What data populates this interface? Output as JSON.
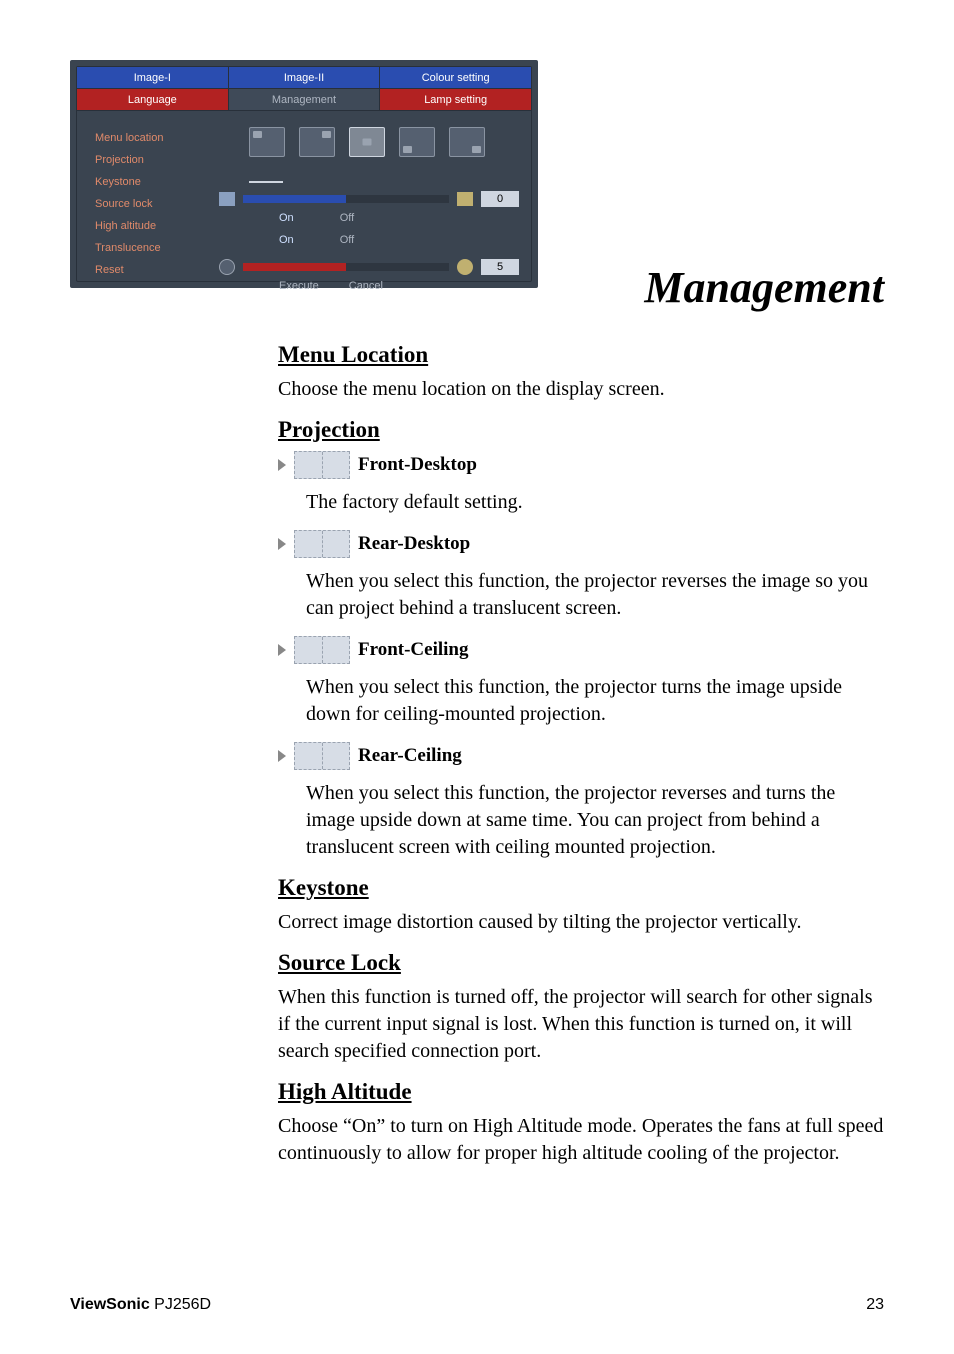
{
  "osd": {
    "tabs_top": [
      "Image-I",
      "Image-II",
      "Colour setting"
    ],
    "tabs_bottom": [
      "Language",
      "Management",
      "Lamp setting"
    ],
    "items": {
      "menu_location": "Menu location",
      "projection": "Projection",
      "keystone": "Keystone",
      "source_lock": "Source lock",
      "high_altitude": "High altitude",
      "translucence": "Translucence",
      "reset": "Reset"
    },
    "values": {
      "keystone": "0",
      "source_lock_on": "On",
      "source_lock_off": "Off",
      "high_altitude_on": "On",
      "high_altitude_off": "Off",
      "translucence": "5",
      "reset_execute": "Execute",
      "reset_cancel": "Cancel"
    }
  },
  "title": "Management",
  "sections": {
    "menu_location": {
      "heading": "Menu Location",
      "body": "Choose the menu location on the display screen."
    },
    "projection": {
      "heading": "Projection",
      "front_desktop": {
        "label": "Front-Desktop",
        "body": "The factory default setting."
      },
      "rear_desktop": {
        "label": "Rear-Desktop",
        "body": "When you select this function, the projector reverses the image so you can project behind a translucent screen."
      },
      "front_ceiling": {
        "label": "Front-Ceiling",
        "body": "When you select this function, the projector turns the image upside down for ceiling-mounted projection."
      },
      "rear_ceiling": {
        "label": "Rear-Ceiling",
        "body": "When you select this function, the projector reverses and turns the image upside down at same time. You can project from behind a translucent screen with ceiling mounted projection."
      }
    },
    "keystone": {
      "heading": "Keystone",
      "body": "Correct image distortion caused by tilting the projector vertically."
    },
    "source_lock": {
      "heading": "Source Lock",
      "body": "When this function is turned off, the projector will search for other signals if the current input signal is lost. When this function is turned on, it will search specified connection port."
    },
    "high_altitude": {
      "heading": "High Altitude",
      "body": "Choose “On” to turn on High Altitude mode. Operates the fans at full speed continuously to allow for proper high altitude cooling of the projector."
    }
  },
  "footer": {
    "brand": "ViewSonic",
    "model": " PJ256D",
    "page": "23"
  }
}
